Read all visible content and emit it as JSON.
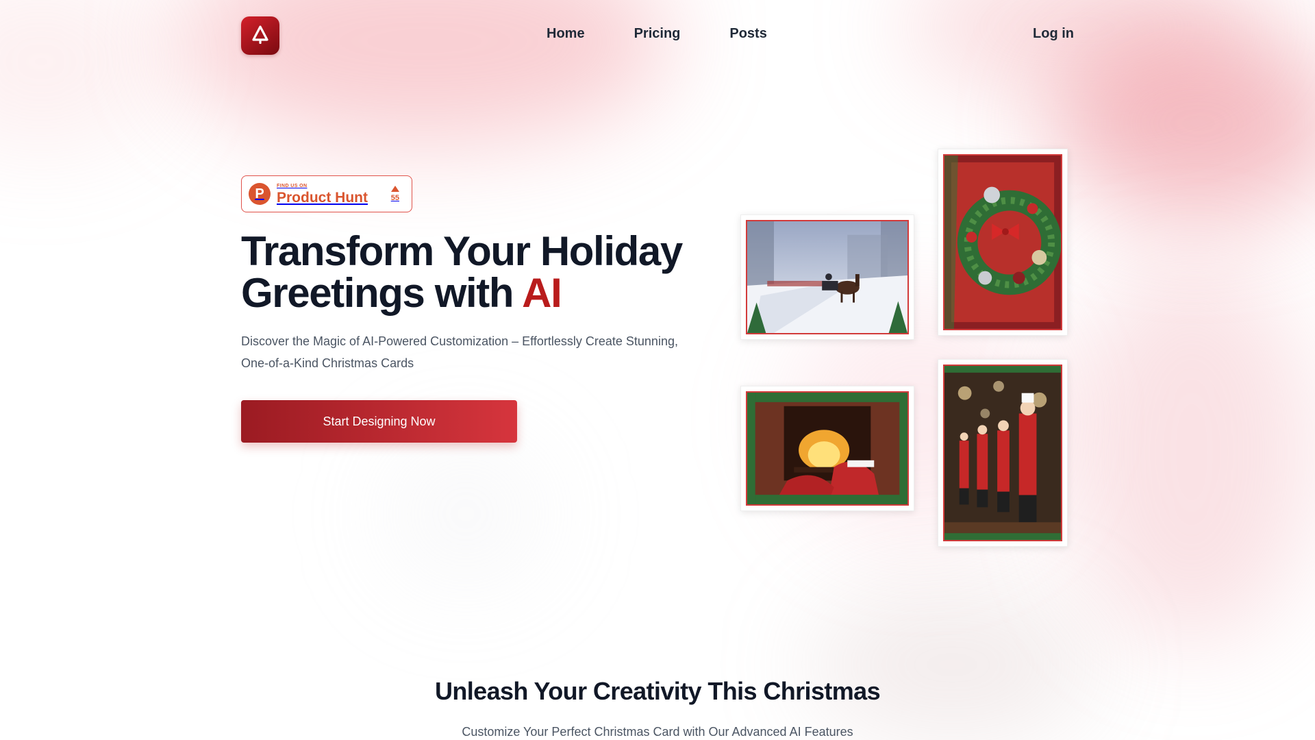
{
  "header": {
    "logo_icon": "christmas-tree-icon",
    "nav": [
      {
        "label": "Home"
      },
      {
        "label": "Pricing"
      },
      {
        "label": "Posts"
      }
    ],
    "login_label": "Log in"
  },
  "product_hunt": {
    "small_text": "FIND US ON",
    "name": "Product Hunt",
    "logo_letter": "P",
    "votes": "55"
  },
  "hero": {
    "title_line1": "Transform Your Holiday",
    "title_line2_prefix": "Greetings with ",
    "title_highlight": "AI",
    "subtitle": "Discover the Magic of AI-Powered Customization – Effortlessly Create Stunning, One-of-a-Kind Christmas Cards",
    "cta_label": "Start Designing Now"
  },
  "cards": [
    {
      "image": "horse-sleigh-snow-scene"
    },
    {
      "image": "christmas-wreath"
    },
    {
      "image": "fireplace-stockings"
    },
    {
      "image": "nutcracker-soldiers"
    }
  ],
  "section": {
    "title": "Unleash Your Creativity This Christmas",
    "subtitle": "Customize Your Perfect Christmas Card with Our Advanced AI Features"
  },
  "colors": {
    "accent": "#b91c1c",
    "cta_start": "#9b1b22",
    "cta_end": "#d6353d",
    "product_hunt": "#da552f"
  }
}
